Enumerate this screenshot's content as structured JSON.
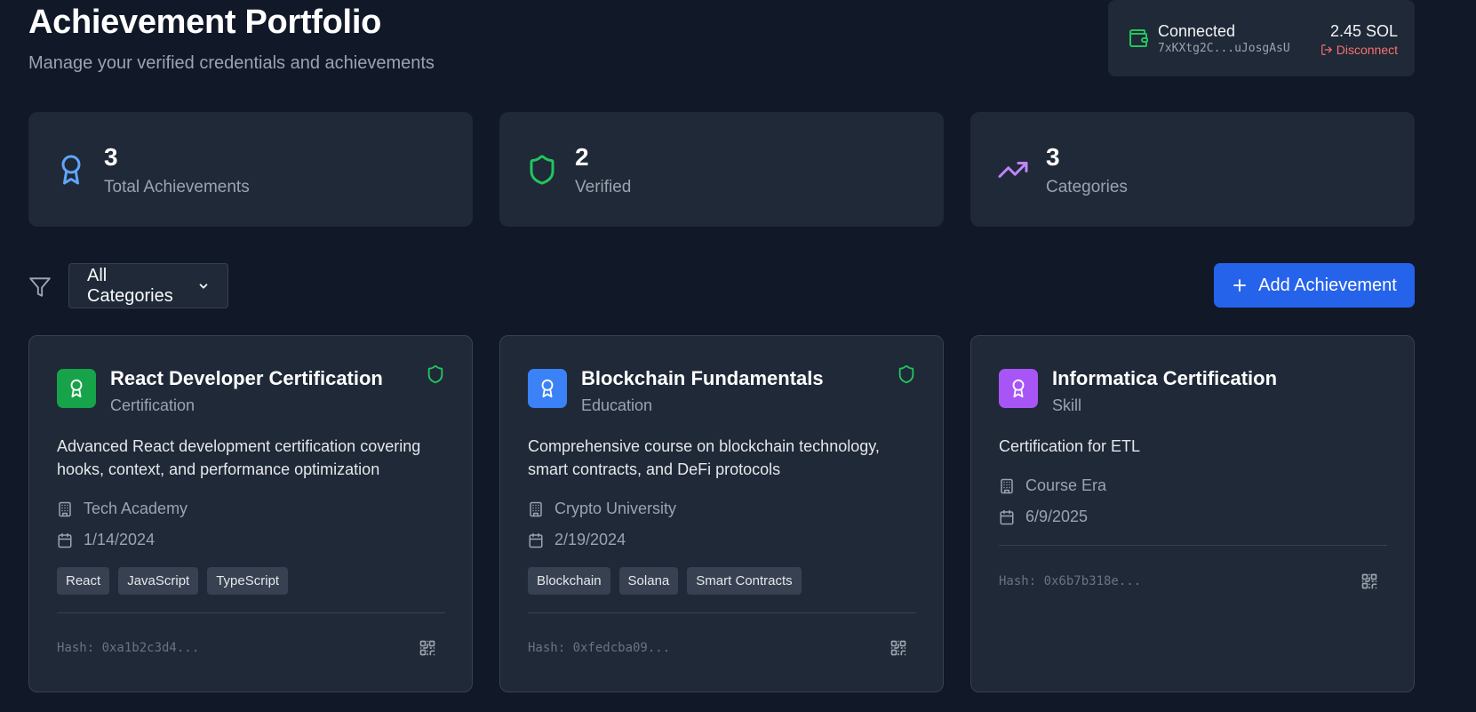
{
  "header": {
    "title": "Achievement Portfolio",
    "subtitle": "Manage your verified credentials and achievements"
  },
  "wallet": {
    "status": "Connected",
    "address": "7xKXtg2C...uJosgAsU",
    "balance": "2.45 SOL",
    "disconnect_label": "Disconnect"
  },
  "stats": [
    {
      "value": "3",
      "label": "Total Achievements",
      "icon": "award-icon",
      "color": "#60a5fa"
    },
    {
      "value": "2",
      "label": "Verified",
      "icon": "shield-icon",
      "color": "#22c55e"
    },
    {
      "value": "3",
      "label": "Categories",
      "icon": "trending-up-icon",
      "color": "#c084fc"
    }
  ],
  "filter": {
    "selected": "All Categories"
  },
  "actions": {
    "add_label": "Add Achievement"
  },
  "achievements": [
    {
      "title": "React Developer Certification",
      "category": "Certification",
      "description": "Advanced React development certification covering hooks, context, and performance optimization",
      "issuer": "Tech Academy",
      "date": "1/14/2024",
      "tags": [
        "React",
        "JavaScript",
        "TypeScript"
      ],
      "hash": "Hash: 0xa1b2c3d4...",
      "verified": true,
      "badge_color": "#16a34a"
    },
    {
      "title": "Blockchain Fundamentals",
      "category": "Education",
      "description": "Comprehensive course on blockchain technology, smart contracts, and DeFi protocols",
      "issuer": "Crypto University",
      "date": "2/19/2024",
      "tags": [
        "Blockchain",
        "Solana",
        "Smart Contracts"
      ],
      "hash": "Hash: 0xfedcba09...",
      "verified": true,
      "badge_color": "#3b82f6"
    },
    {
      "title": "Informatica Certification",
      "category": "Skill",
      "description": "Certification for ETL",
      "issuer": "Course Era",
      "date": "6/9/2025",
      "tags": [],
      "hash": "Hash: 0x6b7b318e...",
      "verified": false,
      "badge_color": "#a855f7"
    }
  ]
}
